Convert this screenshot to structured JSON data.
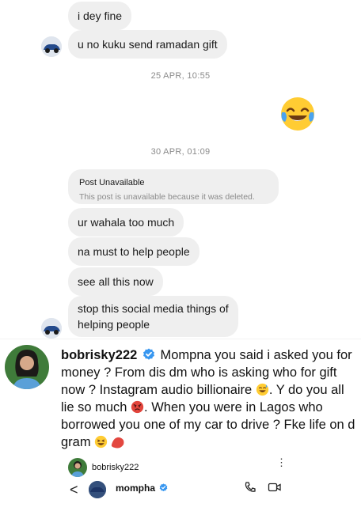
{
  "messages_top": [
    {
      "text": "i dey fine"
    },
    {
      "text": "u no kuku send ramadan gift"
    }
  ],
  "timestamps": [
    "25 APR, 10:55",
    "30 APR, 01:09"
  ],
  "reaction_emoji": "😂",
  "post": {
    "title": "Post Unavailable",
    "subtitle": "This post is unavailable because it was deleted."
  },
  "messages_bottom": [
    {
      "text": "ur wahala too much"
    },
    {
      "text": "na must to help people"
    },
    {
      "text": "see all this now"
    },
    {
      "text_line1": "stop this social media things of",
      "text_line2": "helping people"
    }
  ],
  "comment": {
    "username": "bobrisky222",
    "part1": "Mompna you said i asked you for money ? From dis dm who is asking who for gift now ? Instagram audio billionaire",
    "part2": ". Y do you all lie so much",
    "part3": ". When you were in Lagos who borrowed you one of my car to drive ? F",
    "part4": "ke life on d gram"
  },
  "mini_screenshot": {
    "username": "bobrisky222",
    "menu": "⋮",
    "back": "<",
    "chat_name": "mompha"
  },
  "colors": {
    "bubble": "#efefef",
    "timestamp": "#8a8a8a",
    "verified": "#3897f0"
  }
}
